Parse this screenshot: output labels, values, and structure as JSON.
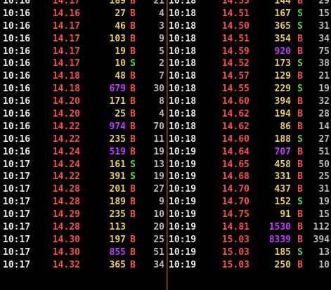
{
  "colors": {
    "background": "#000000",
    "time": "#e8e8e8",
    "price": "#ff4a4a",
    "volume": "#e8d04a",
    "volume_large": "#c23cff",
    "buy": "#ff4a4a",
    "sell": "#3fe04a",
    "count": "#b9b9b9"
  },
  "left_rows": [
    {
      "time": "10:16",
      "price": "14.17",
      "volume": "189",
      "side": "B",
      "count": "21",
      "large": false
    },
    {
      "time": "10:16",
      "price": "14.16",
      "volume": "27",
      "side": "B",
      "count": "4",
      "large": false
    },
    {
      "time": "10:16",
      "price": "14.17",
      "volume": "46",
      "side": "B",
      "count": "3",
      "large": false
    },
    {
      "time": "10:16",
      "price": "14.17",
      "volume": "103",
      "side": "B",
      "count": "9",
      "large": false
    },
    {
      "time": "10:16",
      "price": "14.17",
      "volume": "19",
      "side": "B",
      "count": "5",
      "large": false
    },
    {
      "time": "10:16",
      "price": "14.17",
      "volume": "10",
      "side": "S",
      "count": "2",
      "large": false
    },
    {
      "time": "10:16",
      "price": "14.18",
      "volume": "48",
      "side": "B",
      "count": "7",
      "large": false
    },
    {
      "time": "10:16",
      "price": "14.18",
      "volume": "679",
      "side": "B",
      "count": "30",
      "large": true
    },
    {
      "time": "10:16",
      "price": "14.20",
      "volume": "171",
      "side": "B",
      "count": "8",
      "large": false
    },
    {
      "time": "10:16",
      "price": "14.20",
      "volume": "25",
      "side": "B",
      "count": "4",
      "large": false
    },
    {
      "time": "10:16",
      "price": "14.22",
      "volume": "974",
      "side": "B",
      "count": "70",
      "large": true
    },
    {
      "time": "10:16",
      "price": "14.22",
      "volume": "235",
      "side": "B",
      "count": "11",
      "large": false
    },
    {
      "time": "10:16",
      "price": "14.24",
      "volume": "519",
      "side": "B",
      "count": "19",
      "large": true
    },
    {
      "time": "10:17",
      "price": "14.24",
      "volume": "161",
      "side": "S",
      "count": "13",
      "large": false
    },
    {
      "time": "10:17",
      "price": "14.22",
      "volume": "391",
      "side": "S",
      "count": "19",
      "large": false
    },
    {
      "time": "10:17",
      "price": "14.28",
      "volume": "201",
      "side": "B",
      "count": "27",
      "large": false
    },
    {
      "time": "10:17",
      "price": "14.28",
      "volume": "189",
      "side": "B",
      "count": "9",
      "large": false
    },
    {
      "time": "10:17",
      "price": "14.29",
      "volume": "235",
      "side": "B",
      "count": "10",
      "large": false
    },
    {
      "time": "10:17",
      "price": "14.28",
      "volume": "113",
      "side": "",
      "count": "20",
      "large": false
    },
    {
      "time": "10:17",
      "price": "14.30",
      "volume": "197",
      "side": "B",
      "count": "25",
      "large": false
    },
    {
      "time": "10:17",
      "price": "14.30",
      "volume": "855",
      "side": "B",
      "count": "51",
      "large": true
    },
    {
      "time": "10:17",
      "price": "14.32",
      "volume": "365",
      "side": "B",
      "count": "34",
      "large": false
    }
  ],
  "right_rows": [
    {
      "time": "10:18",
      "price": "14.55",
      "volume": "144",
      "side": "B",
      "count": "29",
      "large": false
    },
    {
      "time": "10:18",
      "price": "14.51",
      "volume": "167",
      "side": "S",
      "count": "15",
      "large": false
    },
    {
      "time": "10:18",
      "price": "14.50",
      "volume": "365",
      "side": "S",
      "count": "31",
      "large": false
    },
    {
      "time": "10:18",
      "price": "14.51",
      "volume": "354",
      "side": "B",
      "count": "34",
      "large": false
    },
    {
      "time": "10:18",
      "price": "14.59",
      "volume": "920",
      "side": "B",
      "count": "75",
      "large": true
    },
    {
      "time": "10:18",
      "price": "14.52",
      "volume": "173",
      "side": "S",
      "count": "38",
      "large": false
    },
    {
      "time": "10:18",
      "price": "14.57",
      "volume": "129",
      "side": "B",
      "count": "21",
      "large": false
    },
    {
      "time": "10:18",
      "price": "14.55",
      "volume": "229",
      "side": "S",
      "count": "19",
      "large": false
    },
    {
      "time": "10:18",
      "price": "14.60",
      "volume": "394",
      "side": "B",
      "count": "32",
      "large": false
    },
    {
      "time": "10:18",
      "price": "14.62",
      "volume": "194",
      "side": "B",
      "count": "28",
      "large": false
    },
    {
      "time": "10:18",
      "price": "14.62",
      "volume": "86",
      "side": "B",
      "count": "14",
      "large": false
    },
    {
      "time": "10:18",
      "price": "14.60",
      "volume": "188",
      "side": "S",
      "count": "27",
      "large": false
    },
    {
      "time": "10:19",
      "price": "14.64",
      "volume": "707",
      "side": "B",
      "count": "51",
      "large": true
    },
    {
      "time": "10:19",
      "price": "14.65",
      "volume": "458",
      "side": "B",
      "count": "50",
      "large": false
    },
    {
      "time": "10:19",
      "price": "14.68",
      "volume": "331",
      "side": "B",
      "count": "25",
      "large": false
    },
    {
      "time": "10:19",
      "price": "14.70",
      "volume": "437",
      "side": "B",
      "count": "31",
      "large": false
    },
    {
      "time": "10:19",
      "price": "14.70",
      "volume": "152",
      "side": "S",
      "count": "19",
      "large": false
    },
    {
      "time": "10:19",
      "price": "14.75",
      "volume": "91",
      "side": "B",
      "count": "15",
      "large": false
    },
    {
      "time": "10:19",
      "price": "14.81",
      "volume": "1530",
      "side": "B",
      "count": "112",
      "large": true
    },
    {
      "time": "10:19",
      "price": "15.03",
      "volume": "8339",
      "side": "B",
      "count": "394",
      "large": true
    },
    {
      "time": "10:19",
      "price": "15.03",
      "volume": "185",
      "side": "S",
      "count": "13",
      "large": false
    },
    {
      "time": "10:19",
      "price": "15.03",
      "volume": "250",
      "side": "B",
      "count": "10",
      "large": false
    }
  ]
}
